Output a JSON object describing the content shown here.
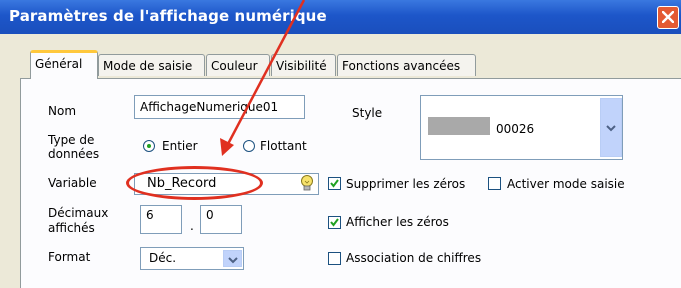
{
  "window": {
    "title": "Paramètres de l'affichage numérique"
  },
  "tabs": [
    {
      "label": "Général"
    },
    {
      "label": "Mode de saisie"
    },
    {
      "label": "Couleur"
    },
    {
      "label": "Visibilité"
    },
    {
      "label": "Fonctions avancées"
    }
  ],
  "form": {
    "nom_label": "Nom",
    "nom_value": "AffichageNumerique01",
    "style_label": "Style",
    "style_value": "00026",
    "type_label_1": "Type de",
    "type_label_2": "données",
    "radio_entier": "Entier",
    "radio_flottant": "Flottant",
    "variable_label": "Variable",
    "variable_value": "Nb_Record",
    "decimaux_label_1": "Décimaux",
    "decimaux_label_2": "affichés",
    "decimaux_int": "6",
    "decimaux_sep": ".",
    "decimaux_frac": "0",
    "format_label": "Format",
    "format_value": "Déc.",
    "check_supprimer": "Supprimer les zéros",
    "check_activer": "Activer mode saisie",
    "check_afficher": "Afficher les zéros",
    "check_association": "Association de chiffres"
  },
  "state": {
    "type_selected": "Entier",
    "supprimer_zeros": true,
    "activer_mode_saisie": false,
    "afficher_zeros": true,
    "association_chiffres": false
  },
  "colors": {
    "annotation": "#e03020",
    "titlebar": "#1d56c9",
    "tab_accent": "#ffc83c"
  },
  "icons": {
    "variable_picker": "lightbulb-icon",
    "close": "close-icon"
  }
}
